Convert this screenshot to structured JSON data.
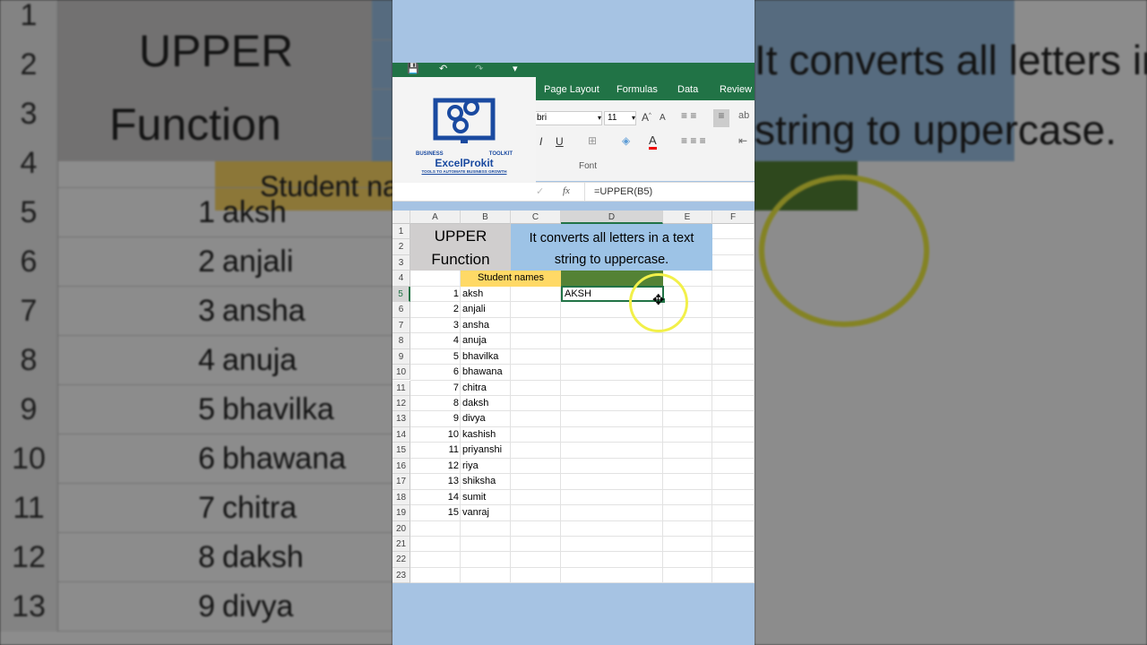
{
  "quick_access": {
    "save": "save-icon",
    "undo": "undo-icon",
    "redo": "redo-icon",
    "customize": "▾"
  },
  "ribbon": {
    "tabs": [
      "Page Layout",
      "Formulas",
      "Data",
      "Review"
    ],
    "font_name": "bri",
    "font_size": "11",
    "font_group": "Font"
  },
  "logo": {
    "top_left": "BUSINESS",
    "top_right": "TOOLKIT",
    "name": "ExcelProkit",
    "tagline": "TOOLS TO AUTOMATE BUSINESS GROWTH"
  },
  "formula_bar": {
    "fx": "fx",
    "formula": "=UPPER(B5)"
  },
  "columns": [
    "A",
    "B",
    "C",
    "D",
    "E",
    "F"
  ],
  "rows": [
    "1",
    "2",
    "3",
    "4",
    "5",
    "6",
    "7",
    "8",
    "9",
    "10",
    "11",
    "12",
    "13",
    "14",
    "15",
    "16",
    "17",
    "18",
    "19",
    "20",
    "21",
    "22",
    "23"
  ],
  "sheet": {
    "title_line1": "UPPER",
    "title_line2": "Function",
    "desc_line1": "It converts all letters in a text",
    "desc_line2": "string to uppercase.",
    "header": "Student names",
    "result_d5": "AKSH",
    "students": [
      {
        "n": "1",
        "name": "aksh"
      },
      {
        "n": "2",
        "name": "anjali"
      },
      {
        "n": "3",
        "name": "ansha"
      },
      {
        "n": "4",
        "name": "anuja"
      },
      {
        "n": "5",
        "name": "bhavilka"
      },
      {
        "n": "6",
        "name": "bhawana"
      },
      {
        "n": "7",
        "name": "chitra"
      },
      {
        "n": "8",
        "name": "daksh"
      },
      {
        "n": "9",
        "name": "divya"
      },
      {
        "n": "10",
        "name": "kashish"
      },
      {
        "n": "11",
        "name": "priyanshi"
      },
      {
        "n": "12",
        "name": "riya"
      },
      {
        "n": "13",
        "name": "shiksha"
      },
      {
        "n": "14",
        "name": "sumit"
      },
      {
        "n": "15",
        "name": "vanraj"
      }
    ]
  },
  "colors": {
    "excel_green": "#217346",
    "title_gray": "#d0cece",
    "desc_blue": "#9dc3e6",
    "header_yellow": "#ffd966",
    "header_green": "#548235",
    "frame_blue": "#a6c3e3"
  }
}
